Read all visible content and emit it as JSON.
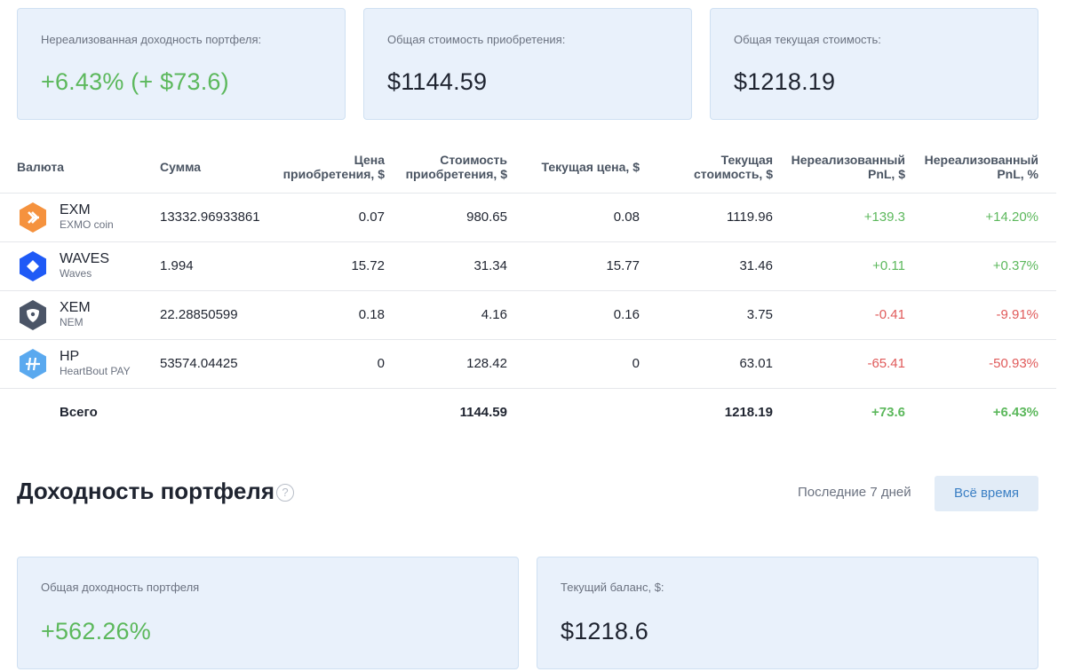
{
  "summary": {
    "unrealized": {
      "label": "Нереализованная доходность портфеля:",
      "value": "+6.43% (+ $73.6)"
    },
    "cost": {
      "label": "Общая стоимость приобретения:",
      "value": "$1144.59"
    },
    "current": {
      "label": "Общая текущая стоимость:",
      "value": "$1218.19"
    }
  },
  "table": {
    "headers": {
      "currency": "Валюта",
      "amount": "Сумма",
      "buy_price_1": "Цена",
      "buy_price_2": "приобретения, $",
      "buy_cost_1": "Стоимость",
      "buy_cost_2": "приобретения, $",
      "cur_price": "Текущая цена, $",
      "cur_value_1": "Текущая",
      "cur_value_2": "стоимость, $",
      "pnl_usd_1": "Нереализованный",
      "pnl_usd_2": "PnL, $",
      "pnl_pct_1": "Нереализованный",
      "pnl_pct_2": "PnL, %"
    },
    "rows": [
      {
        "ticker": "EXM",
        "name": "EXMO coin",
        "icon": "exmo-icon",
        "icon_color": "#f5923e",
        "amount": "13332.96933861",
        "buy_price": "0.07",
        "buy_cost": "980.65",
        "cur_price": "0.08",
        "cur_value": "1119.96",
        "pnl_usd": "+139.3",
        "pnl_pct": "+14.20%"
      },
      {
        "ticker": "WAVES",
        "name": "Waves",
        "icon": "waves-icon",
        "icon_color": "#1f5af6",
        "amount": "1.994",
        "buy_price": "15.72",
        "buy_cost": "31.34",
        "cur_price": "15.77",
        "cur_value": "31.46",
        "pnl_usd": "+0.11",
        "pnl_pct": "+0.37%"
      },
      {
        "ticker": "XEM",
        "name": "NEM",
        "icon": "nem-icon",
        "icon_color": "#4b5567",
        "amount": "22.28850599",
        "buy_price": "0.18",
        "buy_cost": "4.16",
        "cur_price": "0.16",
        "cur_value": "3.75",
        "pnl_usd": "-0.41",
        "pnl_pct": "-9.91%"
      },
      {
        "ticker": "HP",
        "name": "HeartBout PAY",
        "icon": "heartbout-icon",
        "icon_color": "#5aa9ef",
        "amount": "53574.04425",
        "buy_price": "0",
        "buy_cost": "128.42",
        "cur_price": "0",
        "cur_value": "63.01",
        "pnl_usd": "-65.41",
        "pnl_pct": "-50.93%"
      }
    ],
    "total": {
      "label": "Всего",
      "buy_cost": "1144.59",
      "cur_value": "1218.19",
      "pnl_usd": "+73.6",
      "pnl_pct": "+6.43%"
    }
  },
  "profitability": {
    "title": "Доходность портфеля",
    "help_icon": "question-icon",
    "help_glyph": "?",
    "period_7d": "Последние 7 дней",
    "period_all": "Всё время",
    "total": {
      "label": "Общая доходность портфеля",
      "value": "+562.26%"
    },
    "balance": {
      "label": "Текущий баланс, $:",
      "value": "$1218.6"
    }
  },
  "colors": {
    "positive": "#5cb85c",
    "negative": "#e05a5a",
    "card_bg": "#e9f1fb",
    "accent": "#3b7fc4"
  }
}
